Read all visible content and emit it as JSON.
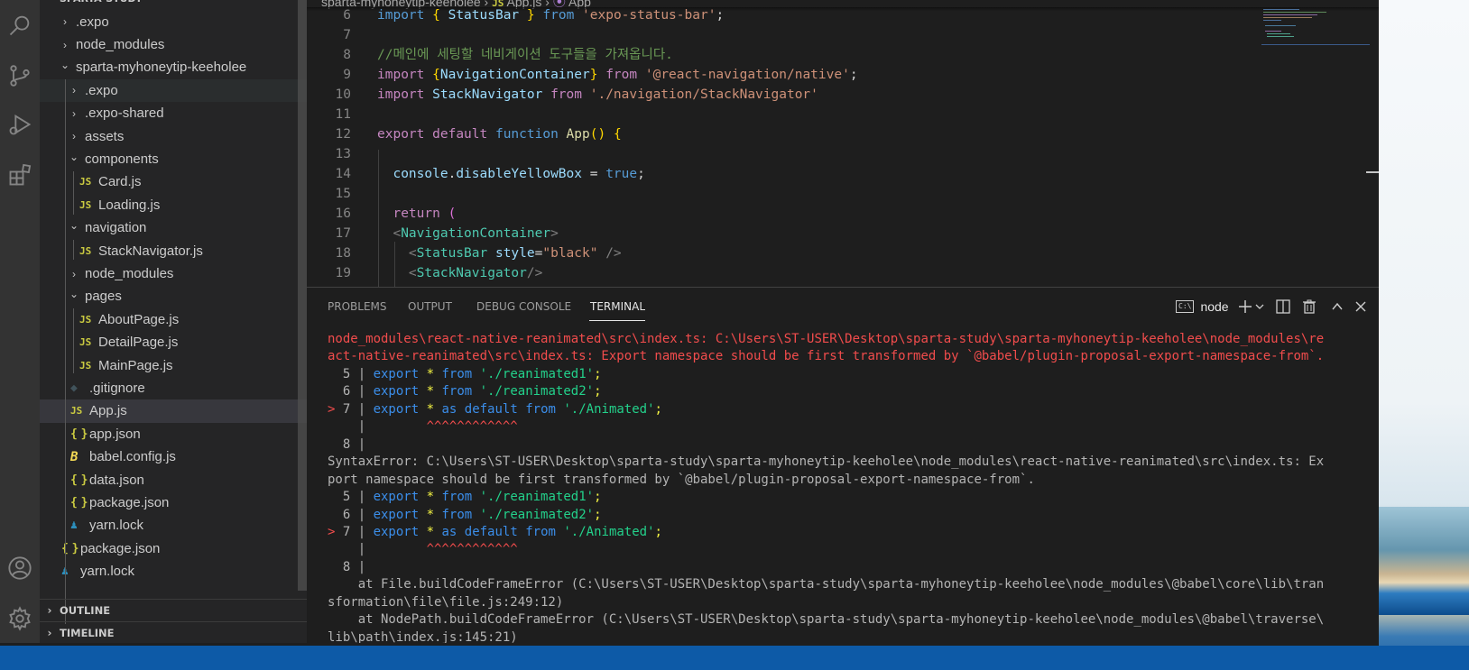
{
  "explorer": {
    "workspace": "SPARTA-STUDY",
    "items": [
      {
        "label": ".expo",
        "type": "folder",
        "open": false,
        "depth": 1
      },
      {
        "label": "node_modules",
        "type": "folder",
        "open": false,
        "depth": 1
      },
      {
        "label": "sparta-myhoneytip-keeholee",
        "type": "folder",
        "open": true,
        "depth": 1
      },
      {
        "label": ".expo",
        "type": "folder",
        "open": false,
        "depth": 2
      },
      {
        "label": ".expo-shared",
        "type": "folder",
        "open": false,
        "depth": 2
      },
      {
        "label": "assets",
        "type": "folder",
        "open": false,
        "depth": 2
      },
      {
        "label": "components",
        "type": "folder",
        "open": true,
        "depth": 2
      },
      {
        "label": "Card.js",
        "type": "js",
        "depth": 3
      },
      {
        "label": "Loading.js",
        "type": "js",
        "depth": 3
      },
      {
        "label": "navigation",
        "type": "folder",
        "open": true,
        "depth": 2
      },
      {
        "label": "StackNavigator.js",
        "type": "js",
        "depth": 3
      },
      {
        "label": "node_modules",
        "type": "folder",
        "open": false,
        "depth": 2
      },
      {
        "label": "pages",
        "type": "folder",
        "open": true,
        "depth": 2
      },
      {
        "label": "AboutPage.js",
        "type": "js",
        "depth": 3
      },
      {
        "label": "DetailPage.js",
        "type": "js",
        "depth": 3
      },
      {
        "label": "MainPage.js",
        "type": "js",
        "depth": 3
      },
      {
        "label": ".gitignore",
        "type": "git",
        "depth": 2
      },
      {
        "label": "App.js",
        "type": "js",
        "depth": 2,
        "selected": true
      },
      {
        "label": "app.json",
        "type": "json",
        "depth": 2
      },
      {
        "label": "babel.config.js",
        "type": "babel",
        "depth": 2
      },
      {
        "label": "data.json",
        "type": "json",
        "depth": 2
      },
      {
        "label": "package.json",
        "type": "json",
        "depth": 2
      },
      {
        "label": "yarn.lock",
        "type": "yarn",
        "depth": 2
      },
      {
        "label": "package.json",
        "type": "json",
        "depth": 1
      },
      {
        "label": "yarn.lock",
        "type": "yarn",
        "depth": 1
      }
    ],
    "outline_label": "OUTLINE",
    "timeline_label": "TIMELINE"
  },
  "breadcrumb": {
    "folder": "sparta-myhoneytip-keeholee",
    "file_icon": "JS",
    "file": "App.js",
    "symbol": "App"
  },
  "editor": {
    "lines": [
      {
        "n": "6",
        "tokens": [
          [
            "t-kw",
            "import"
          ],
          [
            "t-txt",
            " "
          ],
          [
            "t-br",
            "{"
          ],
          [
            "t-txt",
            " "
          ],
          [
            "t-var",
            "StatusBar"
          ],
          [
            "t-txt",
            " "
          ],
          [
            "t-br",
            "}"
          ],
          [
            "t-txt",
            " "
          ],
          [
            "t-kw",
            "from"
          ],
          [
            "t-txt",
            " "
          ],
          [
            "t-str",
            "'expo-status-bar'"
          ],
          [
            "t-txt",
            ";"
          ]
        ]
      },
      {
        "n": "7",
        "tokens": []
      },
      {
        "n": "8",
        "tokens": [
          [
            "t-cmt",
            "//메인에 세팅할 네비게이션 도구들을 가져옵니다."
          ]
        ]
      },
      {
        "n": "9",
        "tokens": [
          [
            "t-ctl",
            "import"
          ],
          [
            "t-txt",
            " "
          ],
          [
            "t-br",
            "{"
          ],
          [
            "t-var",
            "NavigationContainer"
          ],
          [
            "t-br",
            "}"
          ],
          [
            "t-txt",
            " "
          ],
          [
            "t-ctl",
            "from"
          ],
          [
            "t-txt",
            " "
          ],
          [
            "t-str",
            "'@react-navigation/native'"
          ],
          [
            "t-txt",
            ";"
          ]
        ]
      },
      {
        "n": "10",
        "tokens": [
          [
            "t-ctl",
            "import"
          ],
          [
            "t-txt",
            " "
          ],
          [
            "t-var",
            "StackNavigator"
          ],
          [
            "t-txt",
            " "
          ],
          [
            "t-ctl",
            "from"
          ],
          [
            "t-txt",
            " "
          ],
          [
            "t-str",
            "'./navigation/StackNavigator'"
          ]
        ]
      },
      {
        "n": "11",
        "tokens": []
      },
      {
        "n": "12",
        "tokens": [
          [
            "t-ctl",
            "export"
          ],
          [
            "t-txt",
            " "
          ],
          [
            "t-ctl",
            "default"
          ],
          [
            "t-txt",
            " "
          ],
          [
            "t-kw",
            "function"
          ],
          [
            "t-txt",
            " "
          ],
          [
            "t-fn",
            "App"
          ],
          [
            "t-br",
            "()"
          ],
          [
            "t-txt",
            " "
          ],
          [
            "t-br",
            "{"
          ]
        ]
      },
      {
        "n": "13",
        "tokens": []
      },
      {
        "n": "14",
        "tokens": [
          [
            "t-txt",
            "  "
          ],
          [
            "t-var",
            "console"
          ],
          [
            "t-txt",
            "."
          ],
          [
            "t-var",
            "disableYellowBox"
          ],
          [
            "t-txt",
            " = "
          ],
          [
            "t-kw",
            "true"
          ],
          [
            "t-txt",
            ";"
          ]
        ]
      },
      {
        "n": "15",
        "tokens": []
      },
      {
        "n": "16",
        "tokens": [
          [
            "t-txt",
            "  "
          ],
          [
            "t-ctl",
            "return"
          ],
          [
            "t-txt",
            " "
          ],
          [
            "t-br2",
            "("
          ]
        ]
      },
      {
        "n": "17",
        "tokens": [
          [
            "t-txt",
            "  "
          ],
          [
            "t-punct",
            "<"
          ],
          [
            "t-tag",
            "NavigationContainer"
          ],
          [
            "t-punct",
            ">"
          ]
        ]
      },
      {
        "n": "18",
        "tokens": [
          [
            "t-txt",
            "    "
          ],
          [
            "t-punct",
            "<"
          ],
          [
            "t-tag",
            "StatusBar"
          ],
          [
            "t-txt",
            " "
          ],
          [
            "t-var",
            "style"
          ],
          [
            "t-txt",
            "="
          ],
          [
            "t-str",
            "\"black\""
          ],
          [
            "t-txt",
            " "
          ],
          [
            "t-punct",
            "/>"
          ]
        ]
      },
      {
        "n": "19",
        "tokens": [
          [
            "t-txt",
            "    "
          ],
          [
            "t-punct",
            "<"
          ],
          [
            "t-tag",
            "StackNavigator"
          ],
          [
            "t-punct",
            "/>"
          ]
        ]
      }
    ]
  },
  "panel": {
    "tabs": [
      "PROBLEMS",
      "OUTPUT",
      "DEBUG CONSOLE",
      "TERMINAL"
    ],
    "active_tab": "TERMINAL",
    "terminal_name": "node",
    "terminal_icon_label": "C:\\"
  },
  "terminal": {
    "lines": [
      {
        "tokens": [
          [
            "err",
            "node_modules\\react-native-reanimated\\src\\index.ts: C:\\Users\\ST-USER\\Desktop\\sparta-study\\sparta-myhoneytip-keeholee\\node_modules\\re"
          ]
        ]
      },
      {
        "tokens": [
          [
            "err",
            "act-native-reanimated\\src\\index.ts: Export namespace should be first transformed by `@babel/plugin-proposal-export-namespace-from`."
          ]
        ]
      },
      {
        "tokens": [
          [
            "grey",
            "  5 | "
          ],
          [
            "tkw",
            "export"
          ],
          [
            "tpunct",
            " "
          ],
          [
            "tyel",
            "*"
          ],
          [
            "tpunct",
            " "
          ],
          [
            "tkw",
            "from"
          ],
          [
            "tpunct",
            " "
          ],
          [
            "tstr",
            "'./reanimated1'"
          ],
          [
            "tyel",
            ";"
          ]
        ]
      },
      {
        "tokens": [
          [
            "grey",
            "  6 | "
          ],
          [
            "tkw",
            "export"
          ],
          [
            "tpunct",
            " "
          ],
          [
            "tyel",
            "*"
          ],
          [
            "tpunct",
            " "
          ],
          [
            "tkw",
            "from"
          ],
          [
            "tpunct",
            " "
          ],
          [
            "tstr",
            "'./reanimated2'"
          ],
          [
            "tyel",
            ";"
          ]
        ]
      },
      {
        "tokens": [
          [
            "tarrow",
            "> "
          ],
          [
            "grey",
            "7 | "
          ],
          [
            "tkw",
            "export"
          ],
          [
            "tpunct",
            " "
          ],
          [
            "tyel",
            "*"
          ],
          [
            "tpunct",
            " "
          ],
          [
            "tkw",
            "as"
          ],
          [
            "tpunct",
            " "
          ],
          [
            "tkw",
            "default"
          ],
          [
            "tpunct",
            " "
          ],
          [
            "tkw",
            "from"
          ],
          [
            "tpunct",
            " "
          ],
          [
            "tstr",
            "'./Animated'"
          ],
          [
            "tyel",
            ";"
          ]
        ]
      },
      {
        "tokens": [
          [
            "grey",
            "    |        "
          ],
          [
            "tcaret",
            "^^^^^^^^^^^^"
          ]
        ]
      },
      {
        "tokens": [
          [
            "grey",
            "  8 |"
          ]
        ]
      },
      {
        "tokens": [
          [
            "grey",
            "SyntaxError: C:\\Users\\ST-USER\\Desktop\\sparta-study\\sparta-myhoneytip-keeholee\\node_modules\\react-native-reanimated\\src\\index.ts: Ex"
          ]
        ]
      },
      {
        "tokens": [
          [
            "grey",
            "port namespace should be first transformed by `@babel/plugin-proposal-export-namespace-from`."
          ]
        ]
      },
      {
        "tokens": [
          [
            "grey",
            "  5 | "
          ],
          [
            "tkw",
            "export"
          ],
          [
            "tpunct",
            " "
          ],
          [
            "tyel",
            "*"
          ],
          [
            "tpunct",
            " "
          ],
          [
            "tkw",
            "from"
          ],
          [
            "tpunct",
            " "
          ],
          [
            "tstr",
            "'./reanimated1'"
          ],
          [
            "tyel",
            ";"
          ]
        ]
      },
      {
        "tokens": [
          [
            "grey",
            "  6 | "
          ],
          [
            "tkw",
            "export"
          ],
          [
            "tpunct",
            " "
          ],
          [
            "tyel",
            "*"
          ],
          [
            "tpunct",
            " "
          ],
          [
            "tkw",
            "from"
          ],
          [
            "tpunct",
            " "
          ],
          [
            "tstr",
            "'./reanimated2'"
          ],
          [
            "tyel",
            ";"
          ]
        ]
      },
      {
        "tokens": [
          [
            "tarrow",
            "> "
          ],
          [
            "grey",
            "7 | "
          ],
          [
            "tkw",
            "export"
          ],
          [
            "tpunct",
            " "
          ],
          [
            "tyel",
            "*"
          ],
          [
            "tpunct",
            " "
          ],
          [
            "tkw",
            "as"
          ],
          [
            "tpunct",
            " "
          ],
          [
            "tkw",
            "default"
          ],
          [
            "tpunct",
            " "
          ],
          [
            "tkw",
            "from"
          ],
          [
            "tpunct",
            " "
          ],
          [
            "tstr",
            "'./Animated'"
          ],
          [
            "tyel",
            ";"
          ]
        ]
      },
      {
        "tokens": [
          [
            "grey",
            "    |        "
          ],
          [
            "tcaret",
            "^^^^^^^^^^^^"
          ]
        ]
      },
      {
        "tokens": [
          [
            "grey",
            "  8 |"
          ]
        ]
      },
      {
        "tokens": [
          [
            "grey",
            "    at File.buildCodeFrameError (C:\\Users\\ST-USER\\Desktop\\sparta-study\\sparta-myhoneytip-keeholee\\node_modules\\@babel\\core\\lib\\tran"
          ]
        ]
      },
      {
        "tokens": [
          [
            "grey",
            "sformation\\file\\file.js:249:12)"
          ]
        ]
      },
      {
        "tokens": [
          [
            "grey",
            "    at NodePath.buildCodeFrameError (C:\\Users\\ST-USER\\Desktop\\sparta-study\\sparta-myhoneytip-keeholee\\node_modules\\@babel\\traverse\\"
          ]
        ]
      },
      {
        "tokens": [
          [
            "grey",
            "lib\\path\\index.js:145:21)"
          ]
        ]
      }
    ]
  },
  "activity_icons": [
    "search-icon",
    "source-control-icon",
    "run-debug-icon",
    "extensions-icon",
    "accounts-icon",
    "manage-gear-icon"
  ],
  "colors": {
    "activity_bar": "#333333",
    "sidebar": "#252526",
    "editor_bg": "#1e1e1e",
    "taskbar": "#0d5aa7",
    "error_red": "#f14c4c"
  }
}
